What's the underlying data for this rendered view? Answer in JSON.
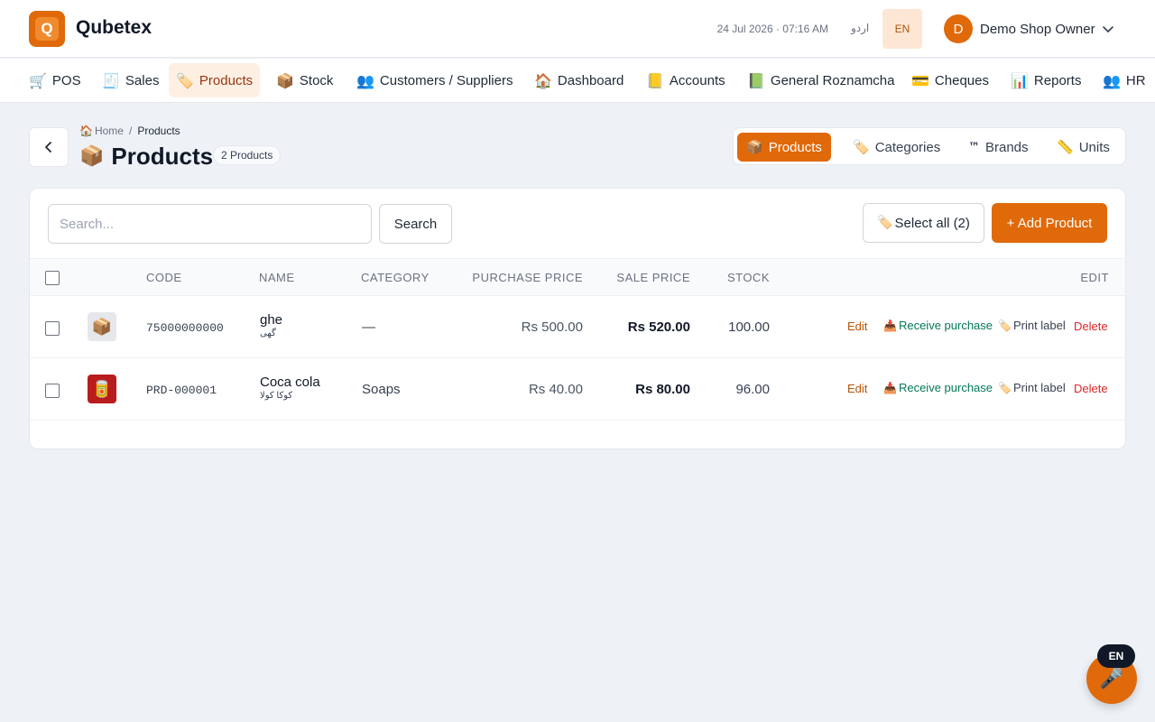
{
  "app": {
    "logo_letter": "Q",
    "title": "Qubetex",
    "accent": "#e0690a"
  },
  "header": {
    "datetime": "24 Jul 2026 · 07:16 AM",
    "lang_urdu": "اردو",
    "lang_en": "EN",
    "user_initial": "D",
    "user_name": "Demo Shop Owner"
  },
  "nav": {
    "items": [
      {
        "icon": "🛒",
        "label": "POS"
      },
      {
        "icon": "🧾",
        "label": "Sales"
      },
      {
        "icon": "🏷️",
        "label": "Products"
      },
      {
        "icon": "📦",
        "label": "Stock"
      },
      {
        "icon": "👥",
        "label": "Customers / Suppliers"
      },
      {
        "icon": "🏠",
        "label": "Dashboard"
      },
      {
        "icon": "📒",
        "label": "Accounts"
      },
      {
        "icon": "📗",
        "label": "General Roznamcha"
      },
      {
        "icon": "💳",
        "label": "Cheques"
      },
      {
        "icon": "📊",
        "label": "Reports"
      },
      {
        "icon": "👥",
        "label": "HR"
      }
    ],
    "active": "Products"
  },
  "breadcrumb": {
    "home_icon": "🏠",
    "home": "Home",
    "separator": "/",
    "current": "Products"
  },
  "page": {
    "title_icon": "📦",
    "title": "Products",
    "count": "2 Products"
  },
  "segments": {
    "items": [
      {
        "icon": "📦",
        "label": "Products"
      },
      {
        "icon": "🏷️",
        "label": "Categories"
      },
      {
        "icon": "™",
        "label": "Brands"
      },
      {
        "icon": "📏",
        "label": "Units"
      }
    ],
    "active": "Products"
  },
  "toolbar": {
    "search_placeholder": "Search...",
    "search_label": "Search",
    "select_all_icon": "🏷️",
    "select_all_label": "Select all (2)",
    "add_label": "+ Add Product"
  },
  "table": {
    "columns": {
      "code": "CODE",
      "name": "NAME",
      "category": "CATEGORY",
      "purchase_price": "PURCHASE PRICE",
      "sale_price": "SALE PRICE",
      "stock": "STOCK",
      "edit": "EDIT"
    },
    "rows": [
      {
        "thumb_icon": "📦",
        "code": "75000000000",
        "name": "ghe",
        "name_urdu": "گھی",
        "category": "—",
        "purchase_price": "Rs 500.00",
        "sale_price": "Rs 520.00",
        "stock": "100.00"
      },
      {
        "thumb_icon": "🥫",
        "code": "PRD-000001",
        "name": "Coca cola",
        "name_urdu": "کوکا کولا",
        "category": "Soaps",
        "purchase_price": "Rs 40.00",
        "sale_price": "Rs 80.00",
        "stock": "96.00"
      }
    ],
    "actions": {
      "edit": "Edit",
      "receive_icon": "📥",
      "receive": "Receive purchase",
      "print_icon": "🏷️",
      "print": "Print label",
      "delete": "Delete"
    }
  },
  "voice": {
    "icon": "🎤",
    "lang": "EN"
  }
}
